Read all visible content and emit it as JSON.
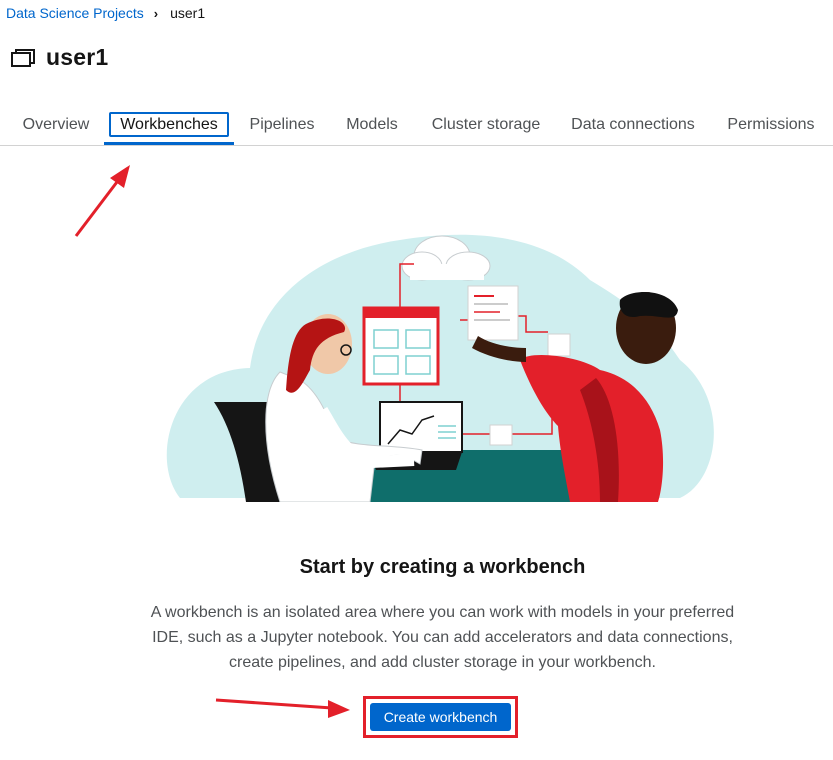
{
  "breadcrumb": {
    "parent": "Data Science Projects",
    "separator": "›",
    "current": "user1"
  },
  "project": {
    "title": "user1",
    "icon": "project-folder-icon"
  },
  "tabs": [
    {
      "label": "Overview",
      "active": false
    },
    {
      "label": "Workbenches",
      "active": true
    },
    {
      "label": "Pipelines",
      "active": false
    },
    {
      "label": "Models",
      "active": false
    },
    {
      "label": "Cluster storage",
      "active": false
    },
    {
      "label": "Data connections",
      "active": false
    },
    {
      "label": "Permissions",
      "active": false
    }
  ],
  "empty_state": {
    "title": "Start by creating a workbench",
    "body_line1": "A workbench is an isolated area where you can work with models in your preferred",
    "body_line2": "IDE, such as a Jupyter notebook. You can add accelerators and data connections,",
    "body_line3": "create pipelines, and add cluster storage in your workbench.",
    "button_label": "Create workbench"
  },
  "colors": {
    "accent": "#0066cc",
    "annotation_red": "#e3202a",
    "illustration_bg": "#cfeeef",
    "illustration_teal": "#0f6e6b"
  }
}
